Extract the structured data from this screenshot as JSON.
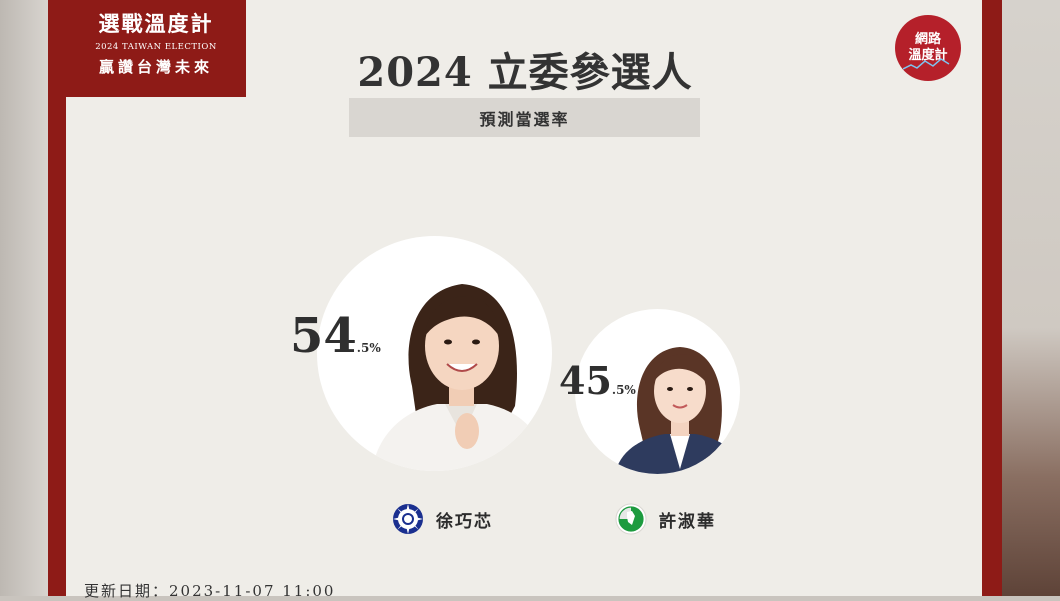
{
  "badge": {
    "title": "選戰溫度計",
    "subtitle_en": "2024 TAIWAN ELECTION",
    "slogan": "贏讚台灣未來"
  },
  "header": {
    "title": "2024 立委參選人",
    "subtitle": "預測當選率"
  },
  "logo": {
    "line1": "網路",
    "line2": "溫度計"
  },
  "candidates": [
    {
      "name": "徐巧芯",
      "percent_main": "54",
      "percent_decimal": ".5%",
      "party_icon": "kmt-emblem-icon",
      "rate": 54.5
    },
    {
      "name": "許淑華",
      "percent_main": "45",
      "percent_decimal": ".5%",
      "party_icon": "dpp-emblem-icon",
      "rate": 45.5
    }
  ],
  "footer": {
    "updated": "更新日期：2023-11-07 11:00"
  },
  "colors": {
    "brand_red": "#8e1b17",
    "card_bg": "#efede8",
    "logo_red": "#b5202a"
  }
}
